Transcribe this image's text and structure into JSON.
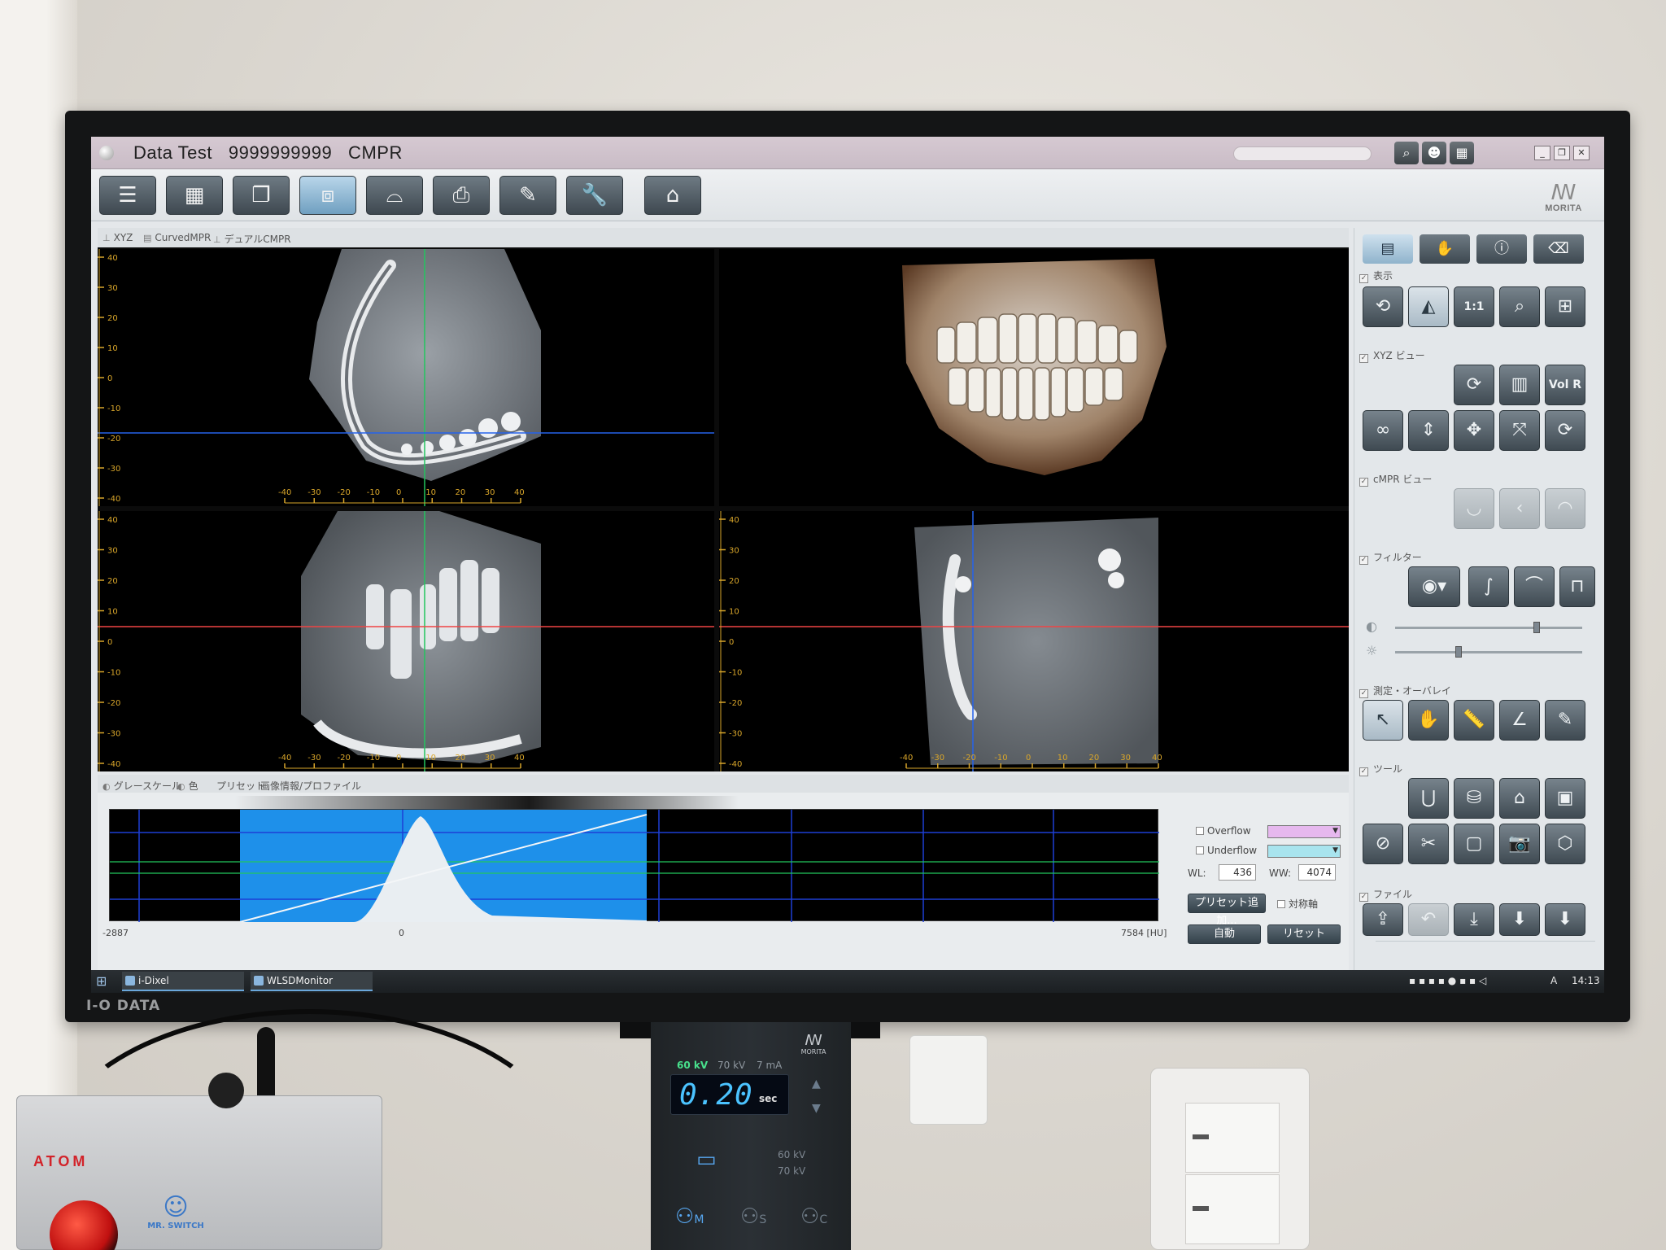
{
  "window": {
    "title": "Data Test   9999999999   CMPR"
  },
  "brand": {
    "software_logo": "MORITA",
    "monitor_brand": "I-O DATA"
  },
  "toolbar": {
    "buttons": [
      {
        "name": "list",
        "icon": "list-icon",
        "glyph": "☰"
      },
      {
        "name": "thumbnails",
        "icon": "grid-icon",
        "glyph": "▦"
      },
      {
        "name": "stack",
        "icon": "layers-icon",
        "glyph": "❐"
      },
      {
        "name": "3d-view",
        "icon": "cube-icon",
        "glyph": "⧈",
        "active": true
      },
      {
        "name": "panoramic",
        "icon": "jaw-icon",
        "glyph": "⌓"
      },
      {
        "name": "print",
        "icon": "printer-icon",
        "glyph": "⎙"
      },
      {
        "name": "report",
        "icon": "notepad-icon",
        "glyph": "✎"
      },
      {
        "name": "tools",
        "icon": "wrench-icon",
        "glyph": "🔧"
      },
      {
        "name": "home",
        "icon": "home-icon",
        "glyph": "⌂"
      }
    ]
  },
  "view_tabs": [
    "XYZ",
    "CurvedMPR",
    "デュアルCMPR"
  ],
  "axes": {
    "vertical_ticks": [
      "40",
      "30",
      "20",
      "10",
      "0",
      "-10",
      "-20",
      "-30",
      "-40"
    ],
    "horizontal_ticks": [
      "-40",
      "-30",
      "-20",
      "-10",
      "0",
      "10",
      "20",
      "30",
      "40"
    ]
  },
  "bottom_tabs": [
    "グレースケール",
    "色",
    "プリセット",
    "画像情報/プロファイル"
  ],
  "histogram": {
    "min_label": "-2887",
    "zero_label": "0",
    "max_label": "7584 [HU]"
  },
  "window_level": {
    "overflow_label": "Overflow",
    "underflow_label": "Underflow",
    "overflow_color": "#e6b8ee",
    "underflow_color": "#a8e4ee",
    "wl_label": "WL:",
    "wl_value": "436",
    "ww_label": "WW:",
    "ww_value": "4074",
    "preset_add_label": "プリセット追加...",
    "symmetric_label": "対称軸",
    "auto_label": "自動",
    "reset_label": "リセット"
  },
  "right_panel": {
    "top_tabs": [
      "display-tab",
      "hand-tab",
      "info-tab",
      "eraser-tab"
    ],
    "sections": {
      "display": "表示",
      "xyz_view": "XYZ ビュー",
      "cmpr_view": "cMPR ビュー",
      "filter": "フィルター",
      "measure_overlay": "測定・オーバレイ",
      "tools": "ツール",
      "file": "ファイル"
    },
    "vol_r_label": "Vol R"
  },
  "taskbar": {
    "apps": [
      "i-Dixel",
      "WLSDMonitor"
    ],
    "time": "14:13",
    "ime": "A"
  },
  "xray_controller": {
    "brand": "MORITA",
    "kv_options": [
      "60 kV",
      "70 kV"
    ],
    "ma": "7 mA",
    "exposure": "0.20",
    "unit": "sec",
    "kv_pair": [
      "60 kV",
      "70 kV"
    ],
    "modes": [
      "M",
      "S",
      "C"
    ]
  },
  "switch_box": {
    "brand": "ATOM",
    "logo_text": "MR. SWITCH"
  }
}
